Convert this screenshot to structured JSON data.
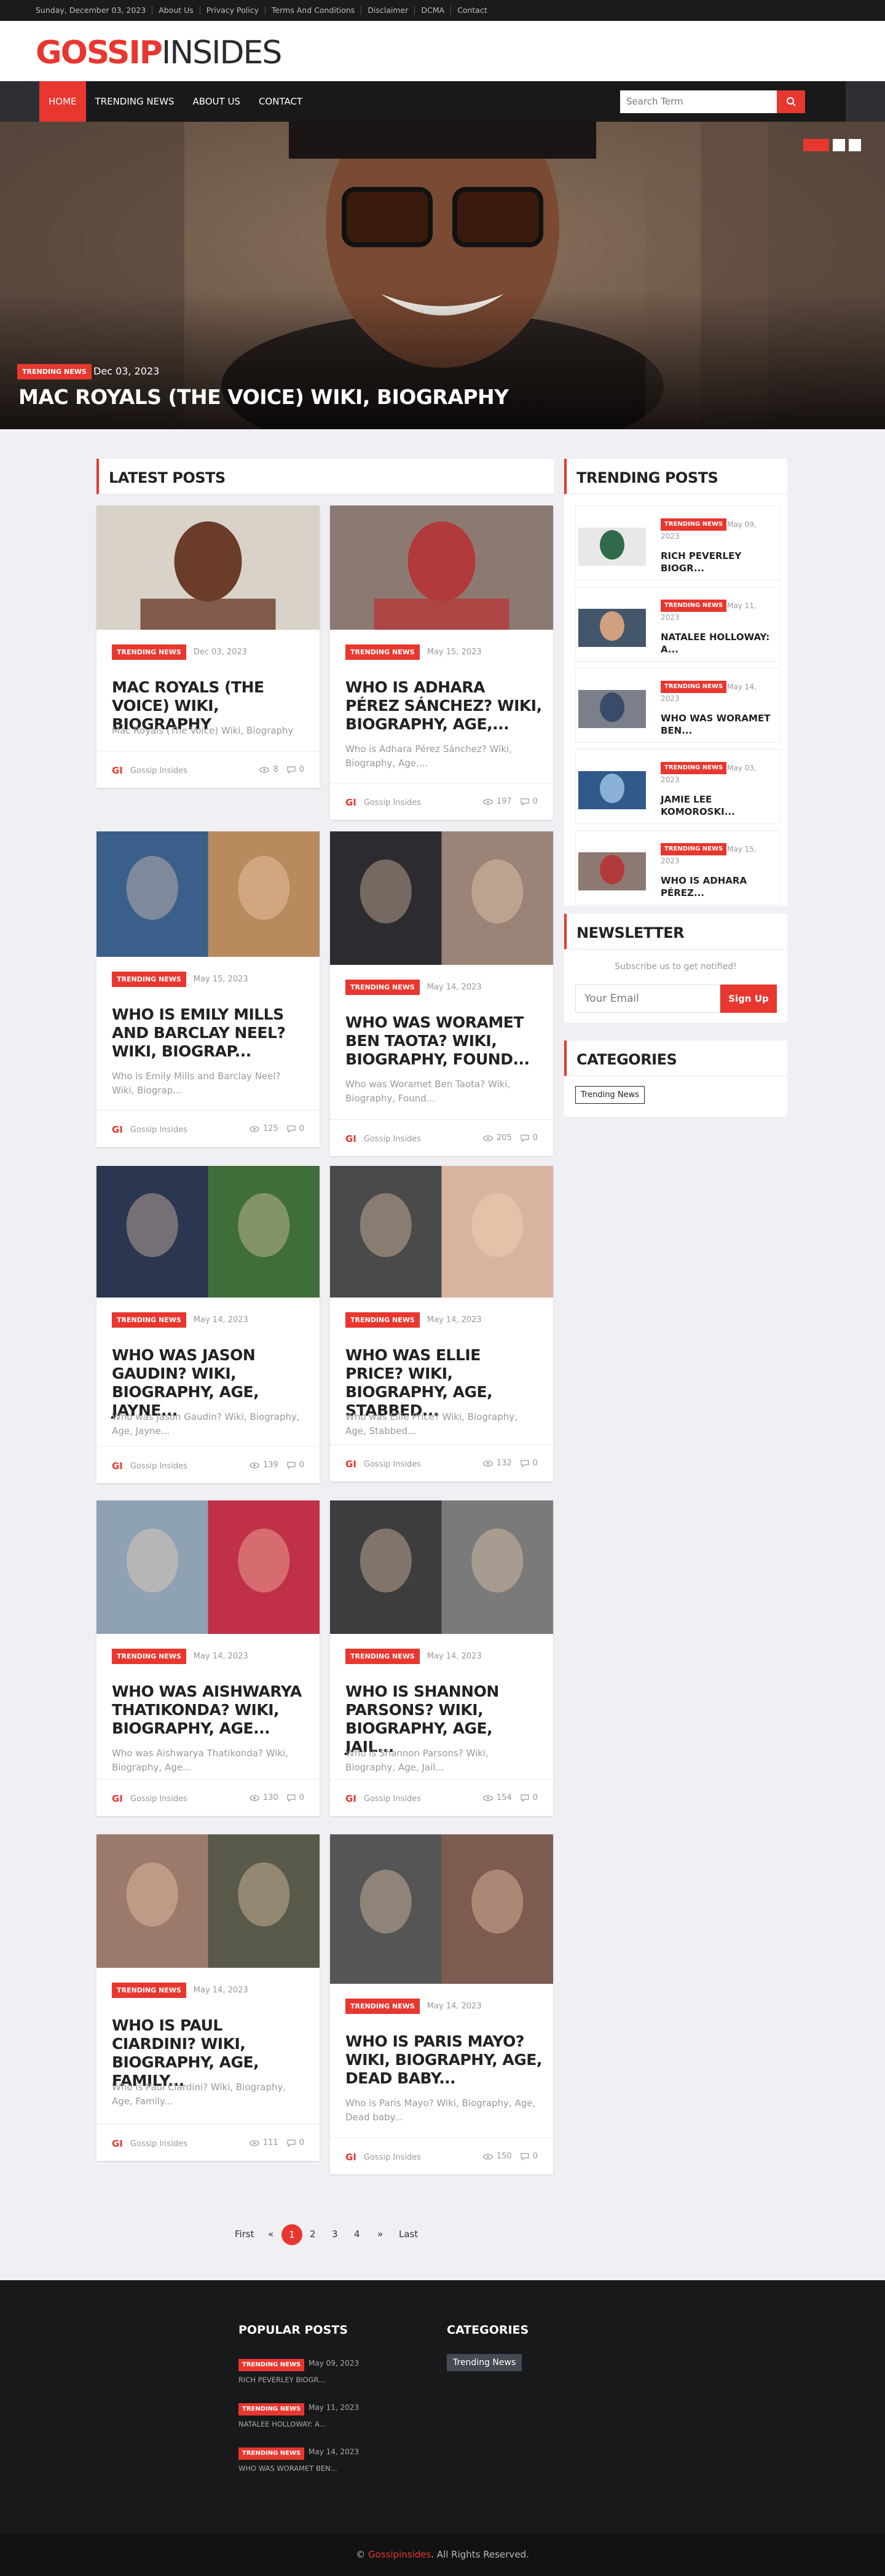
{
  "topbar": {
    "date": "Sunday, December 03, 2023",
    "links": [
      "About Us",
      "Privacy Policy",
      "Terms And Conditions",
      "Disclaimer",
      "DCMA",
      "Contact"
    ]
  },
  "logo": {
    "part1": "GOSSIP",
    "part2": "INSIDES"
  },
  "nav": {
    "items": [
      "HOME",
      "TRENDING NEWS",
      "ABOUT US",
      "CONTACT"
    ],
    "search_placeholder": "Search Term"
  },
  "hero": {
    "tag": "TRENDING NEWS",
    "date": "Dec 03, 2023",
    "title": "MAC ROYALS (THE VOICE) WIKI, BIOGRAPHY"
  },
  "latest": {
    "heading": "LATEST POSTS",
    "posts": [
      {
        "tag": "TRENDING NEWS",
        "date": "Dec 03, 2023",
        "title": "MAC ROYALS (THE VOICE) WIKI, BIOGRAPHY",
        "excerpt": "Mac Royals (The Voice) Wiki, Biography",
        "author": "Gossip Insides",
        "views": "8",
        "comments": "0"
      },
      {
        "tag": "TRENDING NEWS",
        "date": "May 15, 2023",
        "title": "WHO IS ADHARA PÉREZ SÁNCHEZ? WIKI, BIOGRAPHY, AGE,...",
        "excerpt": "Who is Adhara Pérez Sánchez? Wiki, Biography, Age,...",
        "author": "Gossip Insides",
        "views": "197",
        "comments": "0"
      },
      {
        "tag": "TRENDING NEWS",
        "date": "May 15, 2023",
        "title": "WHO IS EMILY MILLS AND BARCLAY NEEL? WIKI, BIOGRAP...",
        "excerpt": "Who is Emily Mills and Barclay Neel? Wiki, Biograp...",
        "author": "Gossip Insides",
        "views": "125",
        "comments": "0"
      },
      {
        "tag": "TRENDING NEWS",
        "date": "May 14, 2023",
        "title": "WHO WAS WORAMET BEN TAOTA? WIKI, BIOGRAPHY, FOUND...",
        "excerpt": "Who was Woramet Ben Taota? Wiki, Biography, Found...",
        "author": "Gossip Insides",
        "views": "205",
        "comments": "0"
      },
      {
        "tag": "TRENDING NEWS",
        "date": "May 14, 2023",
        "title": "WHO WAS JASON GAUDIN? WIKI, BIOGRAPHY, AGE, JAYNE...",
        "excerpt": "Who was Jason Gaudin? Wiki, Biography, Age, Jayne...",
        "author": "Gossip Insides",
        "views": "139",
        "comments": "0"
      },
      {
        "tag": "TRENDING NEWS",
        "date": "May 14, 2023",
        "title": "WHO WAS ELLIE PRICE? WIKI, BIOGRAPHY, AGE, STABBED...",
        "excerpt": "Who was Ellie Price? Wiki, Biography, Age, Stabbed...",
        "author": "Gossip Insides",
        "views": "132",
        "comments": "0"
      },
      {
        "tag": "TRENDING NEWS",
        "date": "May 14, 2023",
        "title": "WHO WAS AISHWARYA THATIKONDA? WIKI, BIOGRAPHY, AGE...",
        "excerpt": "Who was Aishwarya Thatikonda? Wiki, Biography, Age...",
        "author": "Gossip Insides",
        "views": "130",
        "comments": "0"
      },
      {
        "tag": "TRENDING NEWS",
        "date": "May 14, 2023",
        "title": "WHO IS SHANNON PARSONS? WIKI, BIOGRAPHY, AGE, JAIL...",
        "excerpt": "Who is Shannon Parsons? Wiki, Biography, Age, Jail...",
        "author": "Gossip Insides",
        "views": "154",
        "comments": "0"
      },
      {
        "tag": "TRENDING NEWS",
        "date": "May 14, 2023",
        "title": "WHO IS PAUL CIARDINI? WIKI, BIOGRAPHY, AGE, FAMILY...",
        "excerpt": "Who is Paul Ciardini? Wiki, Biography, Age, Family...",
        "author": "Gossip Insides",
        "views": "111",
        "comments": "0"
      },
      {
        "tag": "TRENDING NEWS",
        "date": "May 14, 2023",
        "title": "WHO IS PARIS MAYO? WIKI, BIOGRAPHY, AGE, DEAD BABY...",
        "excerpt": "Who is Paris Mayo? Wiki, Biography, Age, Dead baby...",
        "author": "Gossip Insides",
        "views": "150",
        "comments": "0"
      }
    ]
  },
  "trending": {
    "heading": "TRENDING POSTS",
    "posts": [
      {
        "tag": "TRENDING NEWS",
        "date_a": "May 09,",
        "date_b": "2023",
        "title": "RICH PEVERLEY BIOGR..."
      },
      {
        "tag": "TRENDING NEWS",
        "date_a": "May 11,",
        "date_b": "2023",
        "title": "NATALEE HOLLOWAY: A..."
      },
      {
        "tag": "TRENDING NEWS",
        "date_a": "May 14,",
        "date_b": "2023",
        "title": "WHO WAS WORAMET BEN..."
      },
      {
        "tag": "TRENDING NEWS",
        "date_a": "May 03,",
        "date_b": "2023",
        "title": "JAMIE LEE KOMOROSKI..."
      },
      {
        "tag": "TRENDING NEWS",
        "date_a": "May 15,",
        "date_b": "2023",
        "title": "WHO IS ADHARA PÉREZ..."
      }
    ]
  },
  "newsletter": {
    "heading": "NEWSLETTER",
    "subtitle": "Subscribe us to get notified!",
    "placeholder": "Your Email",
    "button": "Sign Up"
  },
  "categories": {
    "heading": "CATEGORIES",
    "items": [
      "Trending News"
    ]
  },
  "pagination": {
    "first": "First",
    "prev": "«",
    "pages": [
      "1",
      "2",
      "3",
      "4"
    ],
    "next": "»",
    "last": "Last"
  },
  "footer": {
    "popular_heading": "POPULAR POSTS",
    "popular": [
      {
        "tag": "TRENDING NEWS",
        "date": "May 09, 2023",
        "title": "RICH PEVERLEY BIOGR..."
      },
      {
        "tag": "TRENDING NEWS",
        "date": "May 11, 2023",
        "title": "NATALEE HOLLOWAY: A..."
      },
      {
        "tag": "TRENDING NEWS",
        "date": "May 14, 2023",
        "title": "WHO WAS WORAMET BEN..."
      }
    ],
    "categories_heading": "CATEGORIES",
    "category": "Trending News",
    "copyright_prefix": "© ",
    "copyright_brand": "Gossipinsides",
    "copyright_suffix": ". All Rights Reserved."
  },
  "colors": {
    "accent": "#e8372f",
    "dark": "#18191b",
    "page_bg": "#efeff4"
  },
  "icons": [
    "search-icon",
    "eye-icon",
    "comment-icon",
    "author-logo-icon"
  ]
}
